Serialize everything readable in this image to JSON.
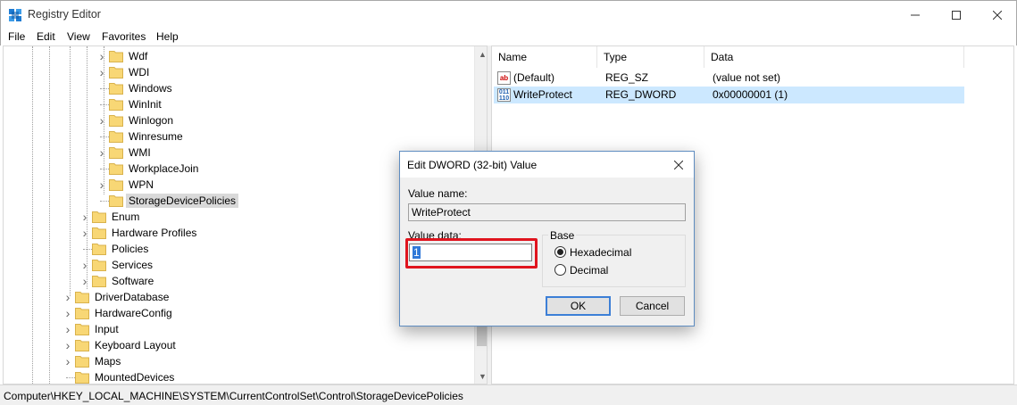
{
  "window": {
    "title": "Registry Editor",
    "icon": "registry-icon"
  },
  "menu": [
    "File",
    "Edit",
    "View",
    "Favorites",
    "Help"
  ],
  "tree": {
    "items": [
      {
        "label": "Wdf",
        "expandable": true
      },
      {
        "label": "WDI",
        "expandable": true
      },
      {
        "label": "Windows",
        "expandable": false
      },
      {
        "label": "WinInit",
        "expandable": false
      },
      {
        "label": "Winlogon",
        "expandable": true
      },
      {
        "label": "Winresume",
        "expandable": false
      },
      {
        "label": "WMI",
        "expandable": true
      },
      {
        "label": "WorkplaceJoin",
        "expandable": false
      },
      {
        "label": "WPN",
        "expandable": true
      },
      {
        "label": "StorageDevicePolicies",
        "expandable": false,
        "selected": true
      },
      {
        "label": "Enum",
        "expandable": true
      },
      {
        "label": "Hardware Profiles",
        "expandable": true
      },
      {
        "label": "Policies",
        "expandable": false
      },
      {
        "label": "Services",
        "expandable": true
      },
      {
        "label": "Software",
        "expandable": true
      },
      {
        "label": "DriverDatabase",
        "expandable": true
      },
      {
        "label": "HardwareConfig",
        "expandable": true
      },
      {
        "label": "Input",
        "expandable": true
      },
      {
        "label": "Keyboard Layout",
        "expandable": true
      },
      {
        "label": "Maps",
        "expandable": true
      },
      {
        "label": "MountedDevices",
        "expandable": false
      }
    ]
  },
  "list": {
    "columns": [
      "Name",
      "Type",
      "Data"
    ],
    "rows": [
      {
        "name": "(Default)",
        "type": "REG_SZ",
        "data": "(value not set)",
        "icon": "string-value-icon",
        "selected": false
      },
      {
        "name": "WriteProtect",
        "type": "REG_DWORD",
        "data": "0x00000001 (1)",
        "icon": "dword-value-icon",
        "selected": true
      }
    ]
  },
  "status": {
    "path": "Computer\\HKEY_LOCAL_MACHINE\\SYSTEM\\CurrentControlSet\\Control\\StorageDevicePolicies"
  },
  "dialog": {
    "title": "Edit DWORD (32-bit) Value",
    "value_name_label": "Value name:",
    "value_name": "WriteProtect",
    "value_data_label": "Value data:",
    "value_data": "1",
    "base_label": "Base",
    "hex_label": "Hexadecimal",
    "dec_label": "Decimal",
    "base_selected": "Hexadecimal",
    "ok_label": "OK",
    "cancel_label": "Cancel"
  },
  "colors": {
    "selection": "#cce8ff",
    "highlight_box": "#e0141e",
    "folder": "#f8d775"
  }
}
